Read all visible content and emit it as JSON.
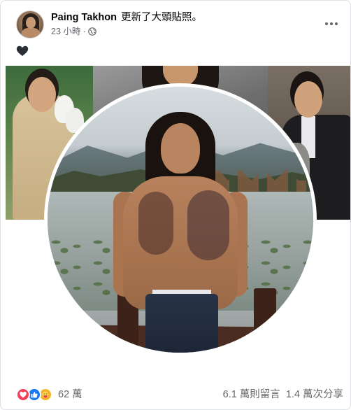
{
  "post": {
    "author": "Paing Takhon",
    "action": "更新了大頭貼照。",
    "time": "23 小時",
    "separator": "·",
    "privacy_icon": "globe-icon",
    "more_icon": "more-options-icon",
    "text_icon": "black-heart-icon"
  },
  "colors": {
    "love": "#f33e58",
    "like": "#1877f2",
    "care": "#f7b125",
    "secondary_text": "#65676b"
  },
  "footer": {
    "reaction_icons": [
      "love-reaction-icon",
      "like-reaction-icon",
      "care-reaction-icon"
    ],
    "reaction_count": "62 萬",
    "comments": "6.1 萬則留言",
    "shares": "1.4 萬次分享"
  }
}
